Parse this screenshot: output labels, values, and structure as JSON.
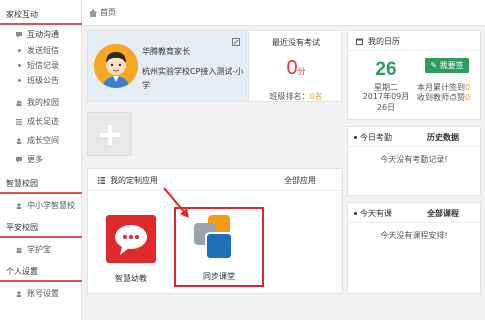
{
  "sidebar": {
    "sections": [
      {
        "title": "家校互动"
      },
      {
        "title": "智慧校园"
      },
      {
        "title": "平安校园"
      },
      {
        "title": "个人设置"
      }
    ],
    "interaction": "互动沟通",
    "sub_items": [
      "发送短信",
      "短信记录",
      "班级公告"
    ],
    "items": [
      "我的校园",
      "成长足迹",
      "成长空间",
      "更多"
    ],
    "smart_school_item": "中小学智慧校",
    "safety_item": "学护宝",
    "account_item": "账号设置"
  },
  "topbar": {
    "breadcrumb": "首页"
  },
  "profile": {
    "school_name": "华腾教育家长",
    "org": "杭州实验学校CP接入测试-小学"
  },
  "exam": {
    "title": "最近没有考试",
    "score": "0",
    "unit": "分",
    "rank_label": "班级排名：",
    "rank_value": "0名"
  },
  "apps": {
    "title": "我的定制应用",
    "all_label": "全部应用",
    "items": [
      {
        "label": "智慧幼教"
      },
      {
        "label": "同步课堂"
      }
    ]
  },
  "calendar": {
    "title": "我的日历",
    "day": "26",
    "weekday": "星期二",
    "date": "2017年09月26日",
    "checkin_label": "我要签",
    "month_sign_label": "本月累计签到",
    "month_sign_value": "0",
    "teacher_likes_label": "收到教师点赞",
    "teacher_likes_value": "0"
  },
  "attendance": {
    "title": "今日考勤",
    "history_label": "历史数据",
    "empty_text": "今天没有考勤记录!"
  },
  "classes": {
    "title": "今天有课",
    "all_label": "全部课程",
    "empty_text": "今天没有课程安排!"
  },
  "colors": {
    "accent_red": "#d9534f",
    "green": "#2e9c5e",
    "score_red": "#e23d3d",
    "orange": "#f39c12"
  }
}
